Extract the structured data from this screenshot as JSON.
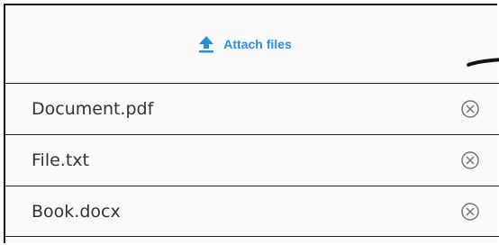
{
  "attach": {
    "label": "Attach files",
    "icon": "upload-icon",
    "accent_color": "#2a8fd8"
  },
  "files": [
    {
      "name": "Document.pdf",
      "remove_icon": "remove-circle-x-icon"
    },
    {
      "name": "File.txt",
      "remove_icon": "remove-circle-x-icon"
    },
    {
      "name": "Book.docx",
      "remove_icon": "remove-circle-x-icon"
    }
  ]
}
